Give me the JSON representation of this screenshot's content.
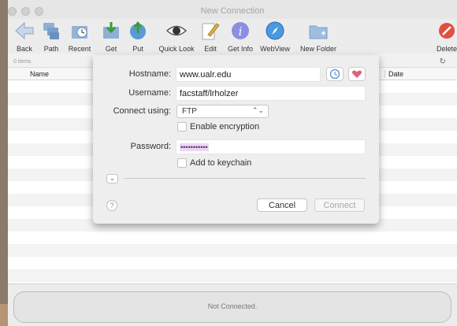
{
  "window": {
    "title": "New Connection"
  },
  "toolbar": {
    "items": [
      {
        "label": "Back",
        "icon": "back-arrow-icon"
      },
      {
        "label": "Path",
        "icon": "path-folders-icon"
      },
      {
        "label": "Recent",
        "icon": "recent-clock-icon"
      },
      {
        "label": "Get",
        "icon": "get-download-icon"
      },
      {
        "label": "Put",
        "icon": "put-upload-icon"
      },
      {
        "label": "Quick Look",
        "icon": "eye-icon"
      },
      {
        "label": "Edit",
        "icon": "edit-pencil-icon"
      },
      {
        "label": "Get Info",
        "icon": "info-icon"
      },
      {
        "label": "WebView",
        "icon": "compass-icon"
      },
      {
        "label": "New Folder",
        "icon": "new-folder-icon"
      },
      {
        "label": "Delete",
        "icon": "delete-icon"
      }
    ]
  },
  "status": {
    "items_count": "0 items"
  },
  "list": {
    "columns": [
      "Name",
      "Date"
    ]
  },
  "connect": {
    "hostname_label": "Hostname:",
    "hostname_value": "www.ualr.edu",
    "username_label": "Username:",
    "username_value": "facstaff/lrholzer",
    "connect_using_label": "Connect using:",
    "connect_using_value": "FTP",
    "encryption_label": "Enable encryption",
    "password_label": "Password:",
    "password_value": "•••••••••••",
    "keychain_label": "Add to keychain",
    "help_glyph": "?",
    "cancel_label": "Cancel",
    "connect_label": "Connect"
  },
  "footer": {
    "status_text": "Not Connected."
  },
  "colors": {
    "accent": "#5b8fd7",
    "favorite": "#e0607a",
    "delete": "#e05040",
    "password_highlight": "#ead9f1"
  }
}
